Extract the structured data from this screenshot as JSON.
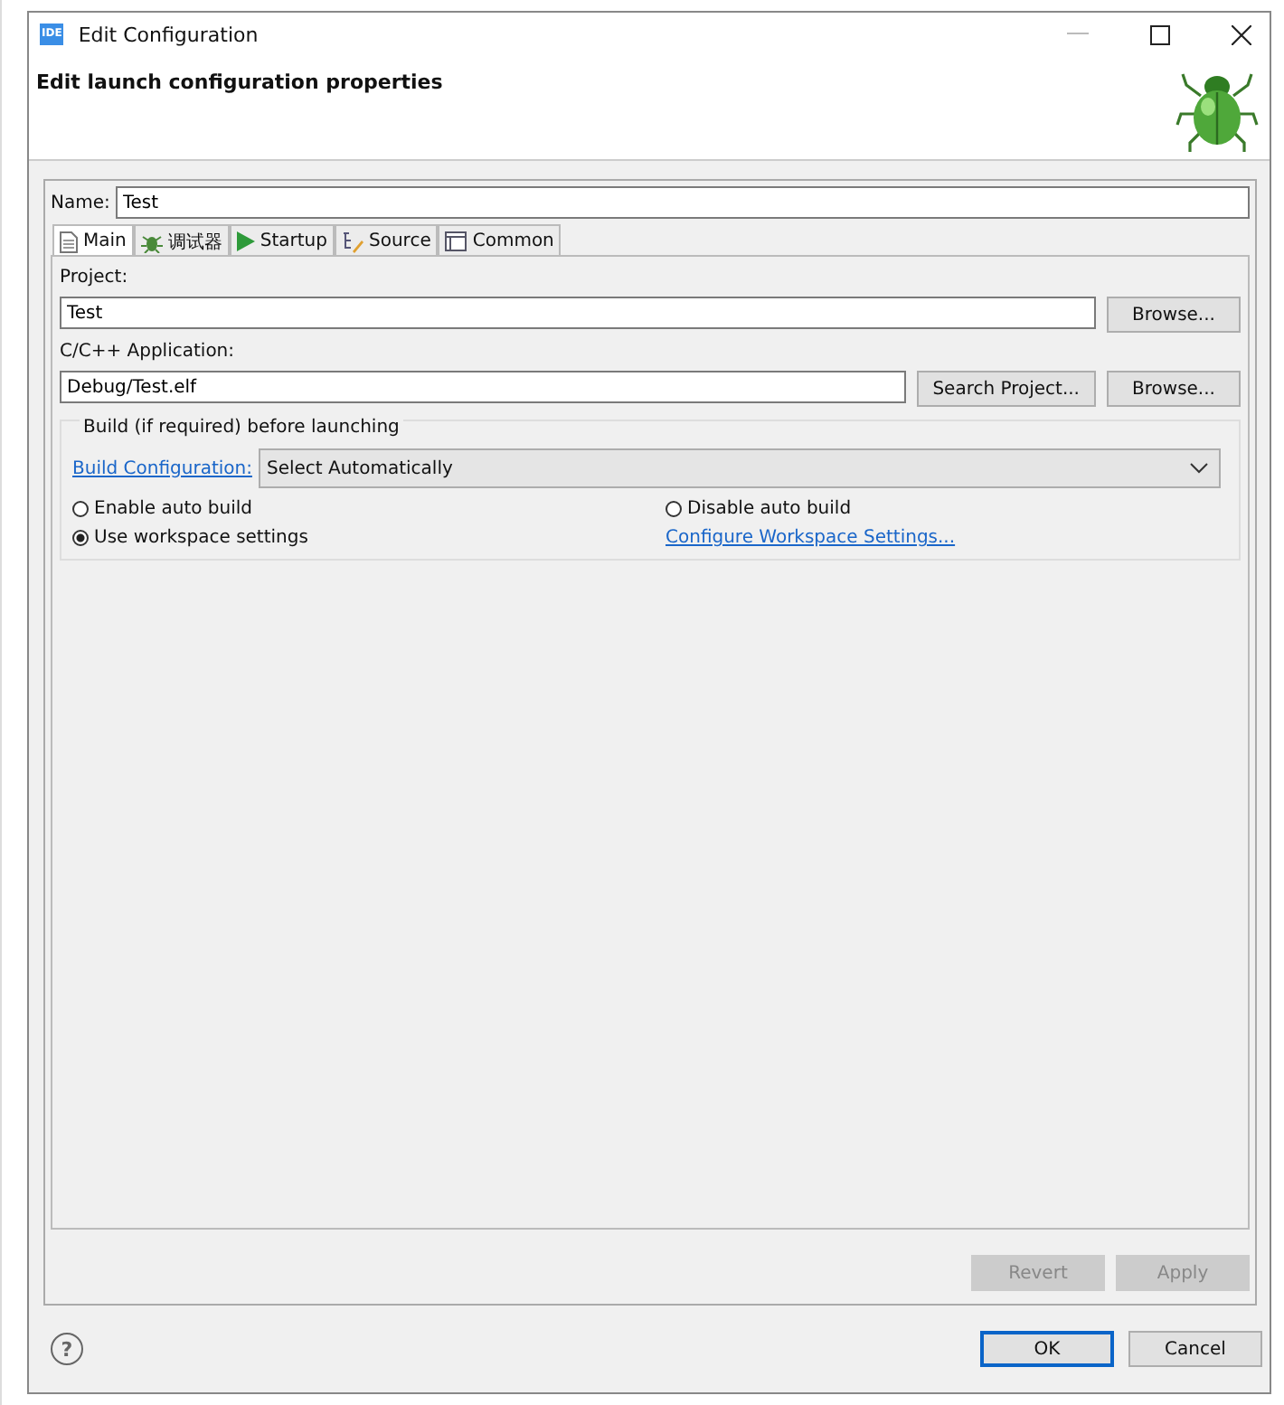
{
  "window": {
    "title": "Edit Configuration",
    "app_icon": "IDE"
  },
  "header": {
    "title": "Edit launch configuration properties"
  },
  "name_field": {
    "label": "Name:",
    "value": "Test"
  },
  "tabs": [
    {
      "label": "Main",
      "kind": "page",
      "selected": true
    },
    {
      "label": "调试器",
      "kind": "bug",
      "selected": false
    },
    {
      "label": "Startup",
      "kind": "play",
      "selected": false
    },
    {
      "label": "Source",
      "kind": "source",
      "selected": false
    },
    {
      "label": "Common",
      "kind": "window",
      "selected": false
    }
  ],
  "project": {
    "label": "Project:",
    "value": "Test",
    "browse": "Browse..."
  },
  "application": {
    "label": "C/C++ Application:",
    "value": "Debug/Test.elf",
    "search": "Search Project...",
    "browse": "Browse..."
  },
  "build": {
    "title": "Build (if required) before launching",
    "config_link": "Build Configuration:",
    "config_value": "Select Automatically",
    "options": [
      {
        "label": "Enable auto build",
        "selected": false
      },
      {
        "label": "Disable auto build",
        "selected": false
      },
      {
        "label": "Use workspace settings",
        "selected": true
      }
    ],
    "workspace_link": "Configure Workspace Settings..."
  },
  "panel_buttons": [
    {
      "label": "Revert",
      "disabled": true
    },
    {
      "label": "Apply",
      "disabled": true
    }
  ],
  "help_icon": "?",
  "dialog_buttons": [
    {
      "label": "OK",
      "default": true
    },
    {
      "label": "Cancel",
      "default": false
    }
  ]
}
